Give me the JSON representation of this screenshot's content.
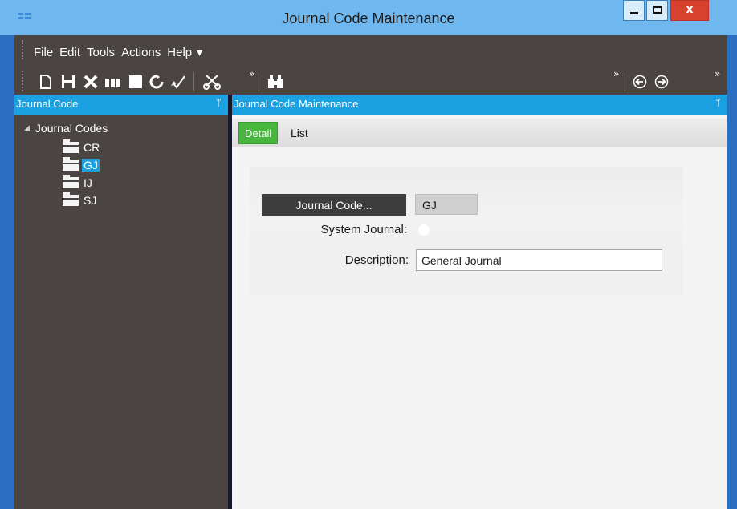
{
  "window": {
    "title": "Journal Code Maintenance",
    "close_glyph": "x"
  },
  "menu": {
    "items": [
      "File",
      "Edit",
      "Tools",
      "Actions",
      "Help"
    ],
    "more": "▾"
  },
  "toolbar": {
    "icons": [
      "new-icon",
      "save-icon",
      "delete-icon",
      "attach-icon",
      "clear-icon",
      "refresh-icon",
      "spelling-icon",
      "cut-icon",
      "search-icon",
      "back-icon",
      "forward-icon"
    ],
    "overflow": "»"
  },
  "left_pane": {
    "header": "Journal Code",
    "pin": "ᛘ",
    "tree": {
      "root": "Journal Codes",
      "nodes": [
        "CR",
        "GJ",
        "IJ",
        "SJ"
      ],
      "selected": "GJ"
    }
  },
  "right_pane": {
    "header": "Journal Code Maintenance",
    "pin": "ᛘ",
    "tabs": [
      "Detail",
      "List"
    ],
    "active_tab": "Detail",
    "form": {
      "journal_code_button": "Journal Code...",
      "journal_code_value": "GJ",
      "system_journal_label": "System Journal:",
      "description_label": "Description:",
      "description_value": "General Journal"
    }
  },
  "colors": {
    "accent": "#1ba1e2",
    "pane_dark": "#4a4543",
    "tab_active": "#46b63d",
    "titlebar": "#6fb8ef",
    "close": "#d9412f"
  }
}
